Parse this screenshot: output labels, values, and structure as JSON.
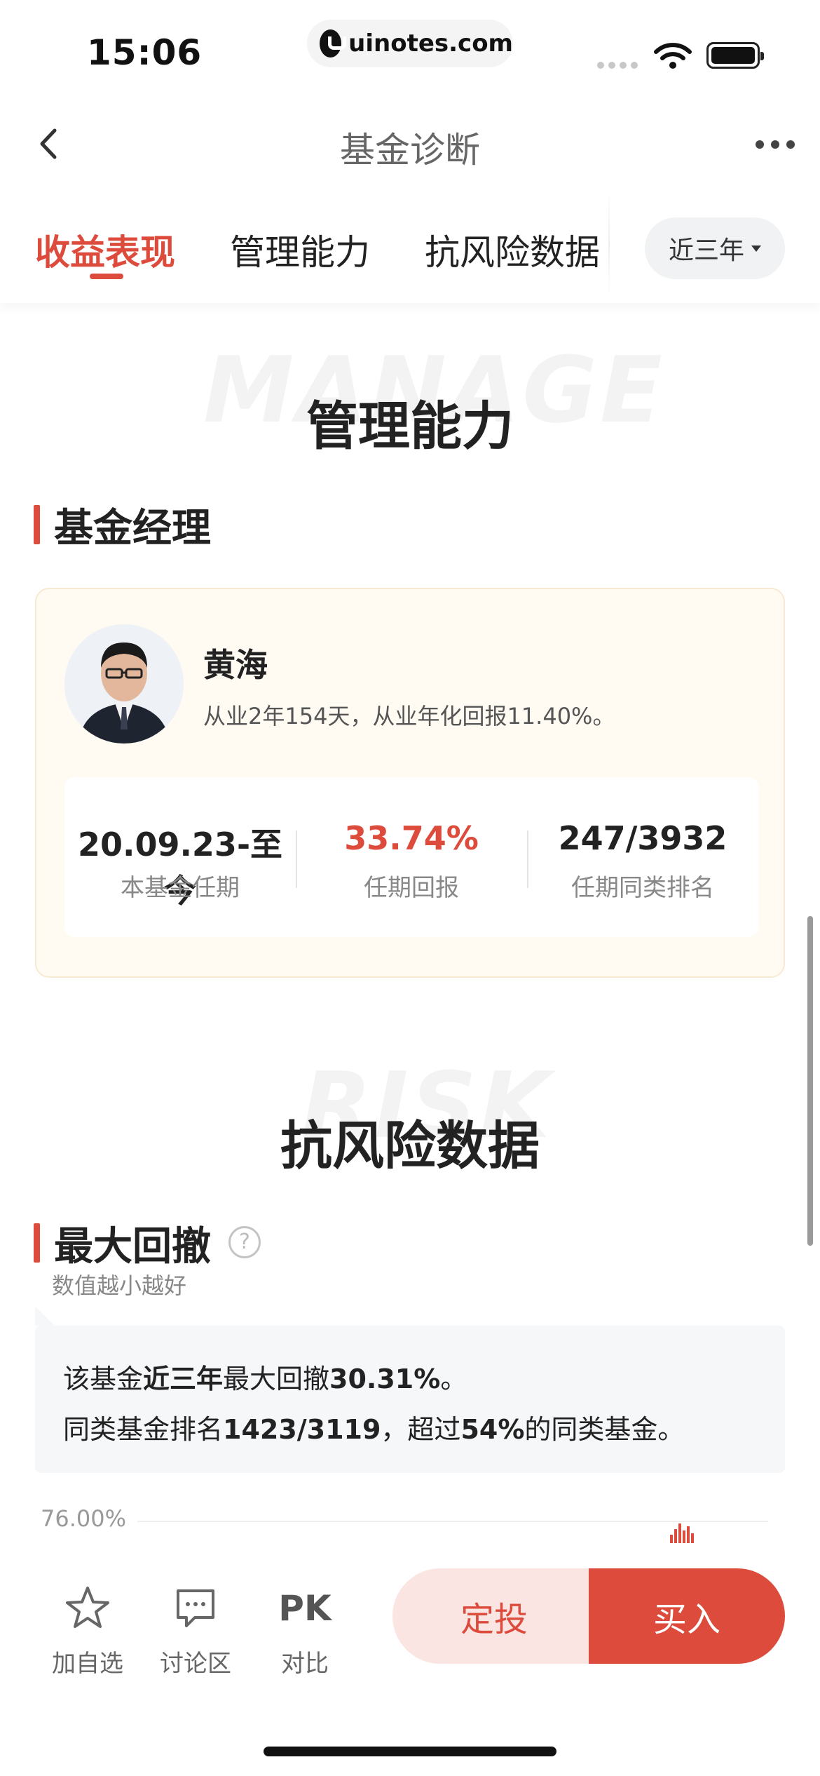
{
  "status_bar": {
    "time": "15:06",
    "url": "uinotes.com"
  },
  "nav": {
    "title": "基金诊断"
  },
  "tabs": {
    "items": [
      {
        "label": "收益表现",
        "active": true
      },
      {
        "label": "管理能力",
        "active": false
      },
      {
        "label": "抗风险数据",
        "active": false
      }
    ],
    "period": "近三年"
  },
  "manage_section": {
    "watermark": "MANAGE",
    "title": "管理能力",
    "sub_title": "基金经理",
    "manager": {
      "name": "黄海",
      "description": "从业2年154天，从业年化回报11.40%。",
      "stats": [
        {
          "value": "20.09.23-至今",
          "label": "本基金任期"
        },
        {
          "value": "33.74%",
          "label": "任期回报"
        },
        {
          "value": "247/3932",
          "label": "任期同类排名"
        }
      ]
    }
  },
  "risk_section": {
    "watermark": "RISK",
    "title": "抗风险数据",
    "sub_title": "最大回撤",
    "help": "?",
    "note": "数值越小越好",
    "info_line1": {
      "pre": "该基金",
      "b1": "近三年",
      "mid": "最大回撤",
      "b2": "30.31%",
      "post": "。"
    },
    "info_line2": {
      "pre": "同类基金排名",
      "b1": "1423/3119",
      "mid": "，超过",
      "b2": "54%",
      "post": "的同类基金。"
    },
    "chart_y_top": "76.00%"
  },
  "bottom_bar": {
    "watchlist": "加自选",
    "discussion": "讨论区",
    "pk_icon": "PK",
    "compare": "对比",
    "auto_invest": "定投",
    "buy": "买入"
  },
  "colors": {
    "accent": "#dc4b3b",
    "card_bg": "#fffaf2"
  }
}
